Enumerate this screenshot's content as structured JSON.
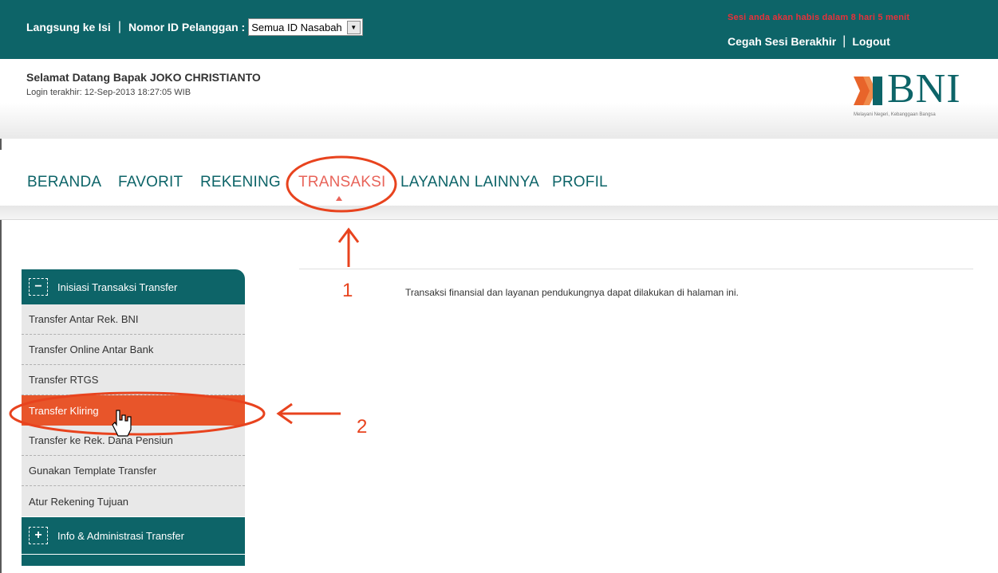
{
  "topbar": {
    "skip_link": "Langsung ke Isi",
    "customer_id_label": "Nomor ID Pelanggan :",
    "customer_id_value": "Semua ID Nasabah",
    "session_warning": "Sesi anda akan habis dalam 8 hari 5 menit",
    "prevent_session_end": "Cegah Sesi Berakhir",
    "logout": "Logout"
  },
  "welcome": {
    "greeting": "Selamat Datang Bapak  JOKO  CHRISTIANTO",
    "last_login": "Login terakhir:  12-Sep-2013 18:27:05  WIB"
  },
  "logo": {
    "name": "BNI",
    "tagline": "Melayani Negeri, Kebanggaan Bangsa"
  },
  "nav": {
    "items": [
      "BERANDA",
      "FAVORIT",
      "REKENING",
      "TRANSAKSI",
      "LAYANAN LAINNYA",
      "PROFIL"
    ],
    "active": "TRANSAKSI"
  },
  "sidebar": {
    "section1_title": "Inisiasi Transaksi Transfer",
    "section1_toggle": "−",
    "items": [
      "Transfer Antar Rek. BNI",
      "Transfer Online Antar Bank",
      "Transfer RTGS",
      "Transfer Kliring",
      "Transfer ke Rek. Dana Pensiun",
      "Gunakan Template Transfer",
      "Atur Rekening Tujuan"
    ],
    "active_item": "Transfer Kliring",
    "section2_title": "Info & Administrasi Transfer",
    "section2_toggle": "+"
  },
  "main": {
    "description": "Transaksi finansial dan layanan pendukungnya dapat dilakukan di halaman ini."
  },
  "annotations": {
    "step1": "1",
    "step2": "2"
  },
  "colors": {
    "brand": "#0d6468",
    "active_nav": "#e8645a",
    "active_item": "#e8552a",
    "annotation": "#e8431e",
    "warning": "#e8313a"
  }
}
